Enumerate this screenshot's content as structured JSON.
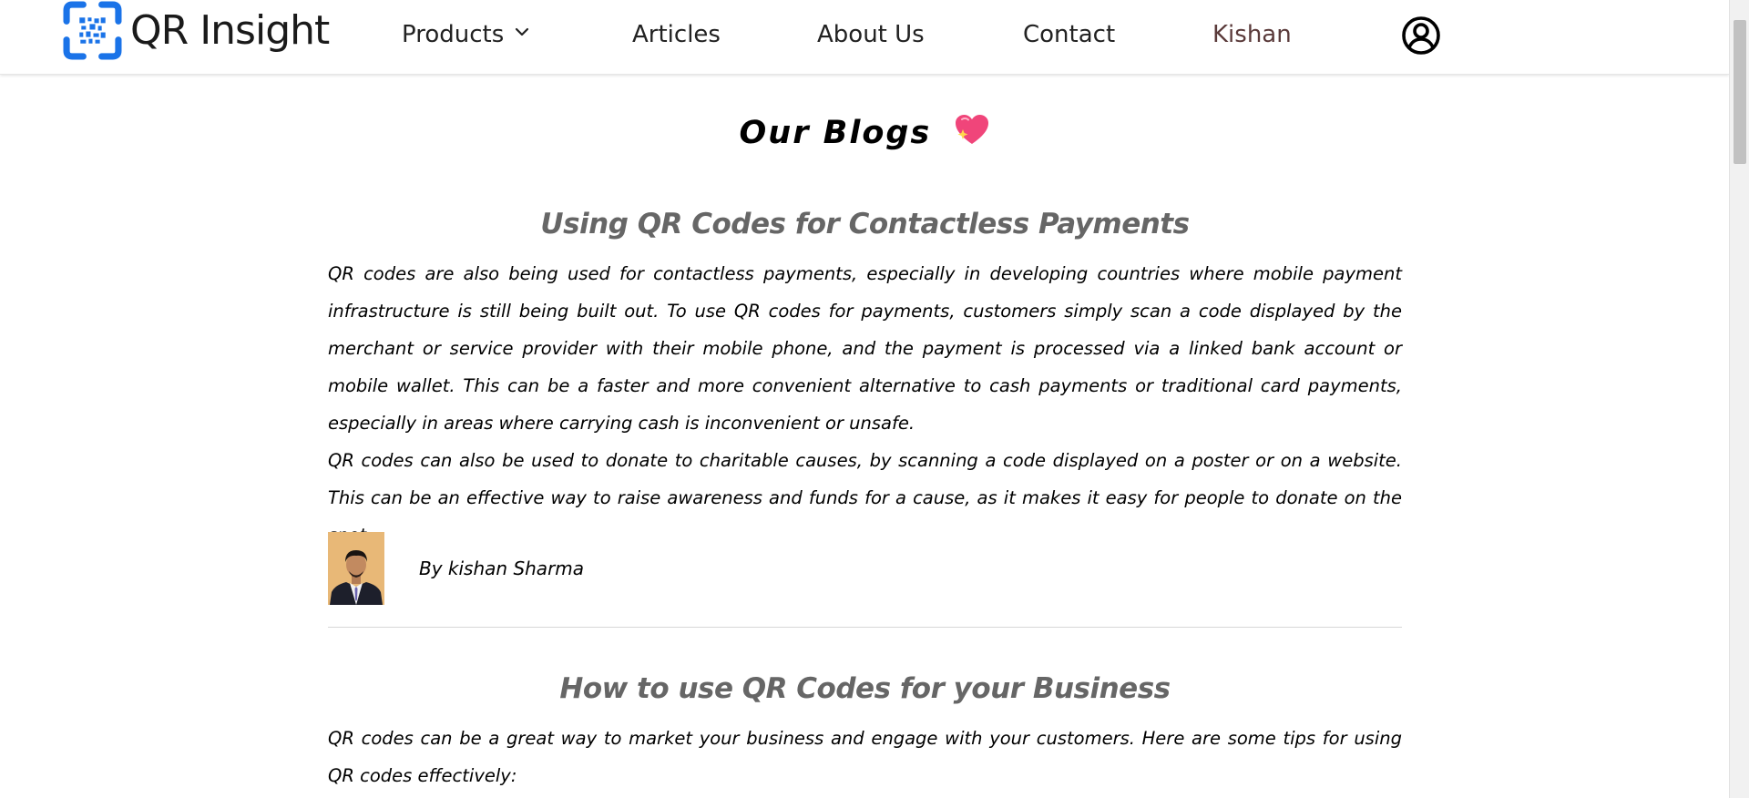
{
  "header": {
    "brand": "QR Insight",
    "nav": {
      "products": "Products",
      "articles": "Articles",
      "about": "About Us",
      "contact": "Contact",
      "user": "Kishan"
    },
    "icons": {
      "logo": "qr-logo-icon",
      "products_dropdown": "chevron-down-icon",
      "account": "user-circle-icon"
    }
  },
  "page": {
    "title": "Our Blogs",
    "title_icon": "sparkling-heart-icon"
  },
  "posts": [
    {
      "title": "Using QR Codes for Contactless Payments",
      "paragraphs": [
        "QR codes are also being used for contactless payments, especially in developing countries where mobile payment infrastructure is still being built out. To use QR codes for payments, customers simply scan a code displayed by the merchant or service provider with their mobile phone, and the payment is processed via a linked bank account or mobile wallet. This can be a faster and more convenient alternative to cash payments or traditional card payments, especially in areas where carrying cash is inconvenient or unsafe.",
        "QR codes can also be used to donate to charitable causes, by scanning a code displayed on a poster or on a website. This can be an effective way to raise awareness and funds for a cause, as it makes it easy for people to donate on the spot."
      ],
      "author": "By kishan Sharma"
    },
    {
      "title": "How to use QR Codes for your Business",
      "paragraphs": [
        "QR codes can be a great way to market your business and engage with your customers. Here are some tips for using QR codes effectively:"
      ]
    }
  ],
  "colors": {
    "brand_blue": "#1a73e8",
    "post_title": "#666666",
    "heart": "#f0457a"
  }
}
